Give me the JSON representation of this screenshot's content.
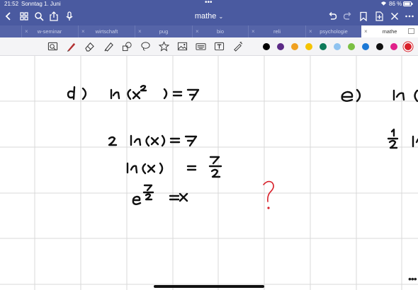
{
  "status": {
    "time": "21:52",
    "date": "Sonntag 1. Juni",
    "battery": "86 %"
  },
  "document": {
    "title": "mathe"
  },
  "tabs": [
    {
      "label": ""
    },
    {
      "label": "w-seminar"
    },
    {
      "label": "wirtschaft"
    },
    {
      "label": "pug"
    },
    {
      "label": "bio"
    },
    {
      "label": "reli"
    },
    {
      "label": "psychologie"
    },
    {
      "label": "mathe",
      "active": true
    }
  ],
  "toolbar": {
    "tools": [
      "lasso-ocr-icon",
      "pen-icon",
      "eraser-icon",
      "highlighter-icon",
      "shapes-icon",
      "lasso-icon",
      "sticker-icon",
      "image-icon",
      "keyboard-icon",
      "text-icon",
      "laser-pointer-icon"
    ],
    "colors": [
      "#000000",
      "#5b2a86",
      "#f0a020",
      "#f5c400",
      "#0e7a5a",
      "#8fc3f0",
      "#7bc043",
      "#1a78d6",
      "#101010",
      "#e0208a",
      "#d8202a"
    ],
    "selected_color": "#d8202a"
  }
}
